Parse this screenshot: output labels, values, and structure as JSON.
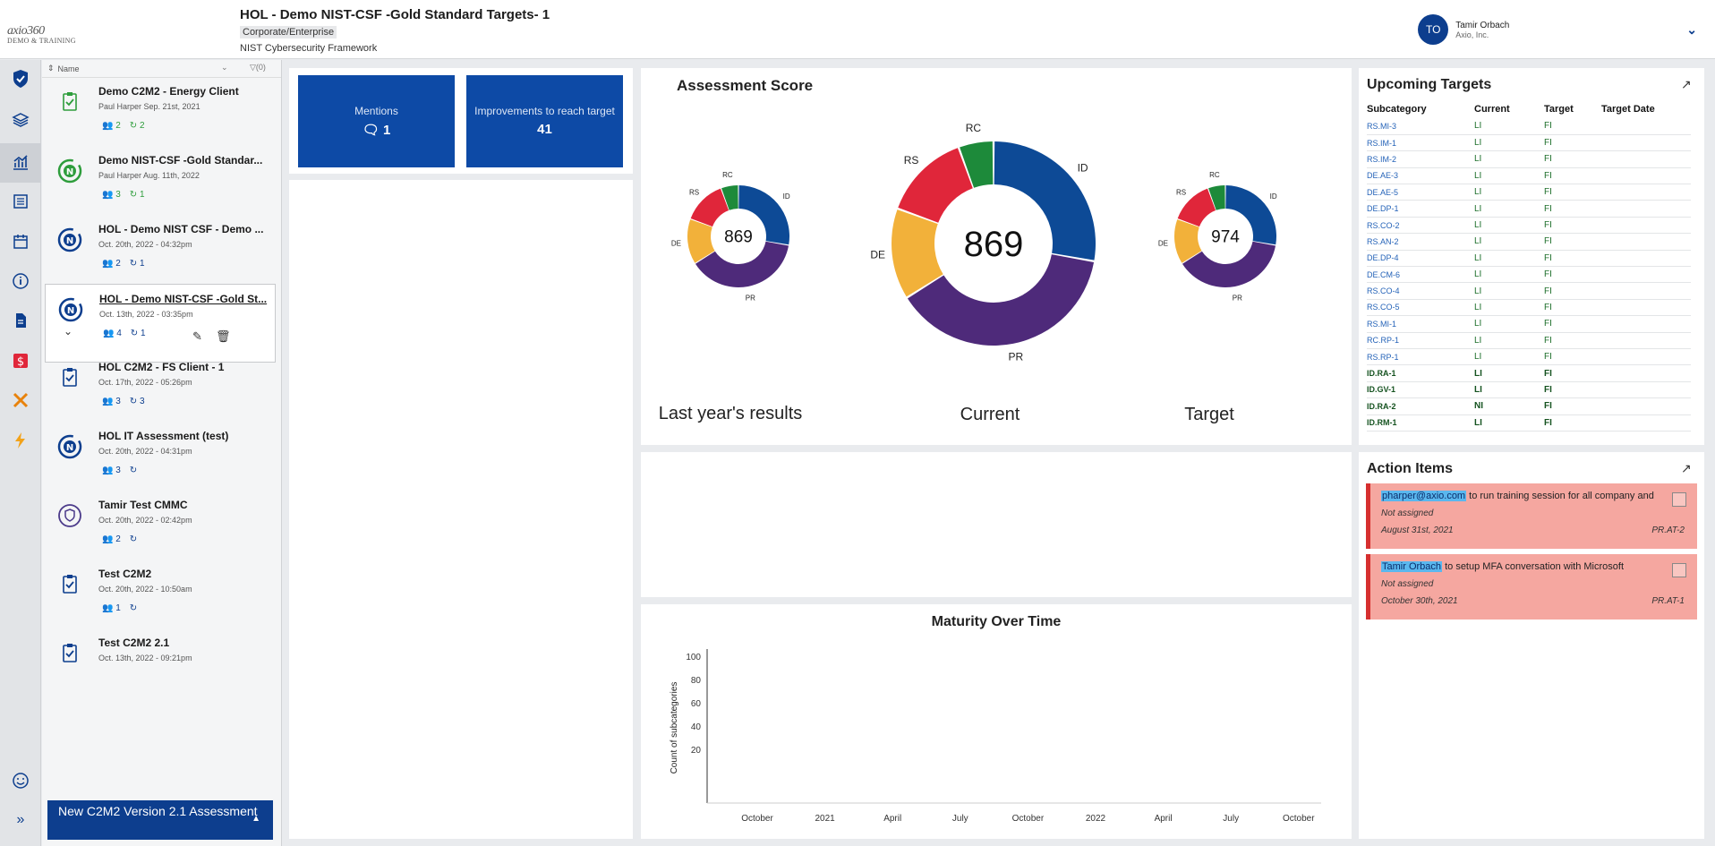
{
  "header": {
    "logo_main": "axio",
    "logo_num": "360",
    "logo_sub": "DEMO & TRAINING",
    "title": "HOL - Demo NIST-CSF -Gold Standard Targets- 1",
    "badge": "Corporate/Enterprise",
    "framework": "NIST Cybersecurity Framework",
    "user_initials": "TO",
    "user_name": "Tamir Orbach",
    "user_org": "Axio, Inc."
  },
  "list": {
    "sort_label": "Name",
    "filter_label": "(0)",
    "items": [
      {
        "name": "Demo C2M2 - Energy Client",
        "meta": "Paul Harper  Sep. 21st, 2021",
        "users": "2",
        "revs": "2",
        "icon": "clipboard-check-icon"
      },
      {
        "name": "Demo NIST-CSF -Gold Standar...",
        "meta": "Paul Harper  Aug. 11th, 2022",
        "users": "3",
        "revs": "1",
        "icon": "nist-icon"
      },
      {
        "name": "HOL - Demo NIST CSF - Demo ...",
        "meta": "Oct. 20th, 2022 - 04:32pm",
        "users": "2",
        "revs": "1",
        "icon": "nist-icon"
      },
      {
        "name": "HOL - Demo NIST-CSF -Gold St...",
        "meta": "Oct. 13th, 2022 - 03:35pm",
        "users": "4",
        "revs": "1",
        "icon": "nist-icon"
      },
      {
        "name": "HOL C2M2 - FS Client - 1",
        "meta": "Oct. 17th, 2022 - 05:26pm",
        "users": "3",
        "revs": "3",
        "icon": "clipboard-check-icon"
      },
      {
        "name": "HOL IT Assessment (test)",
        "meta": "Oct. 20th, 2022 - 04:31pm",
        "users": "3",
        "revs": "",
        "icon": "nist-icon"
      },
      {
        "name": "Tamir Test CMMC",
        "meta": "Oct. 20th, 2022 - 02:42pm",
        "users": "2",
        "revs": "",
        "icon": "shield-icon"
      },
      {
        "name": "Test C2M2",
        "meta": "Oct. 20th, 2022 - 10:50am",
        "users": "1",
        "revs": "",
        "icon": "clipboard-check-icon"
      },
      {
        "name": "Test C2M2 2.1",
        "meta": "Oct. 13th, 2022 - 09:21pm",
        "users": "",
        "revs": "",
        "icon": "clipboard-check-icon"
      }
    ],
    "new_button": "New C2M2 Version 2.1 Assessment"
  },
  "tiles": {
    "mentions_label": "Mentions",
    "mentions_value": "1",
    "improvements_label": "Improvements to reach target",
    "improvements_value": "41"
  },
  "assessment_score": {
    "title": "Assessment Score",
    "last_year": {
      "label": "Last year's results",
      "score": "869"
    },
    "current": {
      "label": "Current",
      "score": "869"
    },
    "target": {
      "label": "Target",
      "score": "974"
    },
    "segments": [
      "ID",
      "PR",
      "DE",
      "RS",
      "RC"
    ],
    "colors": {
      "ID": "#0d4a96",
      "PR": "#4e2a7a",
      "DE": "#f2b13a",
      "RS": "#e0263a",
      "RC": "#1d8a3a"
    }
  },
  "maturity": {
    "title": "Maturity Over Time",
    "ylabel": "Count of subcategories",
    "yticks": [
      "100",
      "80",
      "60",
      "40",
      "20"
    ],
    "xticks": [
      "October",
      "2021",
      "April",
      "July",
      "October",
      "2022",
      "April",
      "July",
      "October"
    ]
  },
  "upcoming": {
    "title": "Upcoming Targets",
    "columns": [
      "Subcategory",
      "Current",
      "Target",
      "Target Date"
    ],
    "rows": [
      [
        "RS.MI-3",
        "LI",
        "FI",
        "",
        false
      ],
      [
        "RS.IM-1",
        "LI",
        "FI",
        "",
        false
      ],
      [
        "RS.IM-2",
        "LI",
        "FI",
        "",
        false
      ],
      [
        "DE.AE-3",
        "LI",
        "FI",
        "",
        false
      ],
      [
        "DE.AE-5",
        "LI",
        "FI",
        "",
        false
      ],
      [
        "DE.DP-1",
        "LI",
        "FI",
        "",
        false
      ],
      [
        "RS.CO-2",
        "LI",
        "FI",
        "",
        false
      ],
      [
        "RS.AN-2",
        "LI",
        "FI",
        "",
        false
      ],
      [
        "DE.DP-4",
        "LI",
        "FI",
        "",
        false
      ],
      [
        "DE.CM-6",
        "LI",
        "FI",
        "",
        false
      ],
      [
        "RS.CO-4",
        "LI",
        "FI",
        "",
        false
      ],
      [
        "RS.CO-5",
        "LI",
        "FI",
        "",
        false
      ],
      [
        "RS.MI-1",
        "LI",
        "FI",
        "",
        false
      ],
      [
        "RC.RP-1",
        "LI",
        "FI",
        "",
        false
      ],
      [
        "RS.RP-1",
        "LI",
        "FI",
        "",
        false
      ],
      [
        "ID.RA-1",
        "LI",
        "FI",
        "",
        true
      ],
      [
        "ID.GV-1",
        "LI",
        "FI",
        "",
        true
      ],
      [
        "ID.RA-2",
        "NI",
        "FI",
        "",
        true
      ],
      [
        "ID.RM-1",
        "LI",
        "FI",
        "",
        true
      ]
    ]
  },
  "actions": {
    "title": "Action Items",
    "items": [
      {
        "who": "pharper@axio.com",
        "text": " to run training session for all company and",
        "assigned": "Not assigned",
        "date": "August 31st, 2021",
        "code": "PR.AT-2"
      },
      {
        "who": "Tamir Orbach",
        "text": " to setup MFA conversation with Microsoft",
        "assigned": "Not assigned",
        "date": "October 30th, 2021",
        "code": "PR.AT-1"
      }
    ]
  }
}
